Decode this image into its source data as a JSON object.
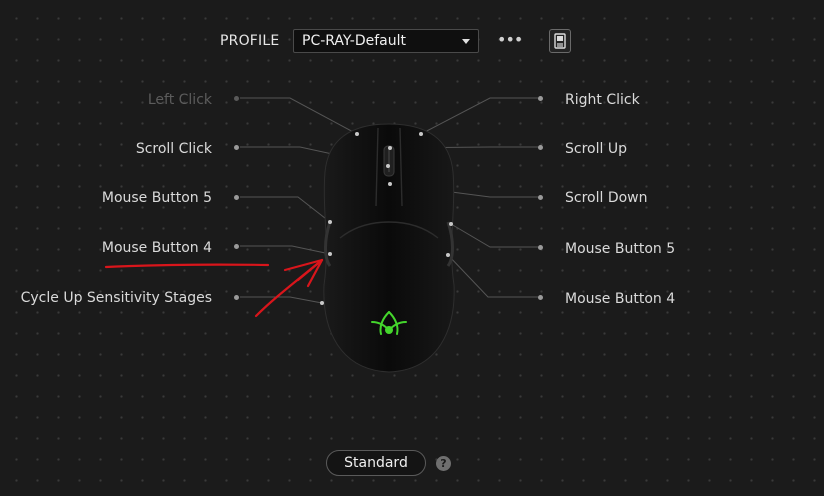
{
  "header": {
    "profile_label": "PROFILE",
    "profile_value": "PC-RAY-Default",
    "more_label": "•••"
  },
  "buttons_left": [
    {
      "label": "Left Click",
      "state": "disabled"
    },
    {
      "label": "Scroll Click",
      "state": "normal"
    },
    {
      "label": "Mouse Button 5",
      "state": "normal"
    },
    {
      "label": "Mouse Button 4",
      "state": "normal"
    },
    {
      "label": "Cycle Up Sensitivity Stages",
      "state": "normal"
    }
  ],
  "buttons_right": [
    {
      "label": "Right Click",
      "state": "normal"
    },
    {
      "label": "Scroll Up",
      "state": "normal"
    },
    {
      "label": "Scroll Down",
      "state": "normal"
    },
    {
      "label": "Mouse Button 5",
      "state": "normal"
    },
    {
      "label": "Mouse Button 4",
      "state": "normal"
    }
  ],
  "footer": {
    "mode_label": "Standard",
    "help_label": "?"
  },
  "colors": {
    "background": "#1b1b1b",
    "logo": "#44d62c",
    "annotation": "#d9151b"
  },
  "icons": {
    "more": "ellipsis-icon",
    "onboard": "onboard-memory-icon",
    "logo": "razer-logo-icon",
    "help": "help-icon"
  }
}
